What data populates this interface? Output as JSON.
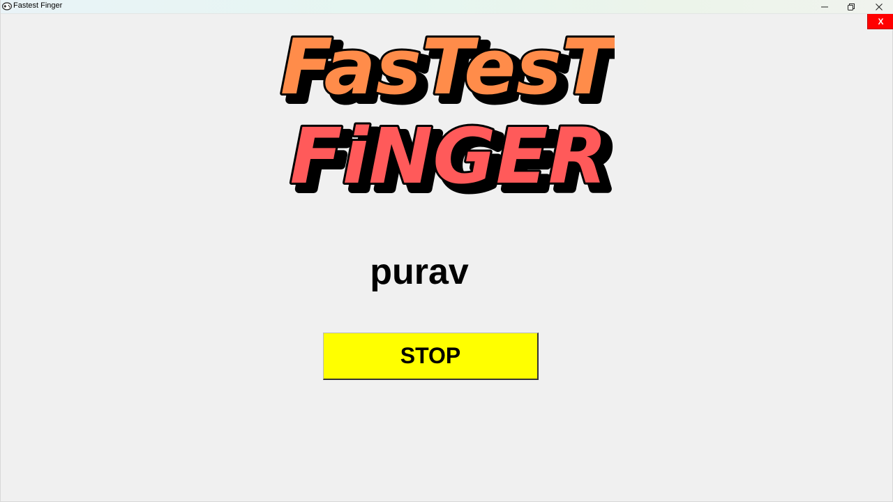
{
  "window": {
    "title": "Fastest Finger",
    "icon": "gamepad-icon"
  },
  "titlebar_controls": {
    "minimize_icon": "minimize-icon",
    "restore_icon": "restore-icon",
    "close_icon": "close-icon"
  },
  "app": {
    "close_label": "X",
    "logo_line1": "FasTesT",
    "logo_line2": "FiNGER",
    "player_name": "purav",
    "stop_label": "STOP"
  },
  "colors": {
    "background": "#f0f0f0",
    "close_button": "#ff0000",
    "stop_button": "#ffff00",
    "logo_line1": "#ff8c4a",
    "logo_line2": "#ff5a5a"
  }
}
